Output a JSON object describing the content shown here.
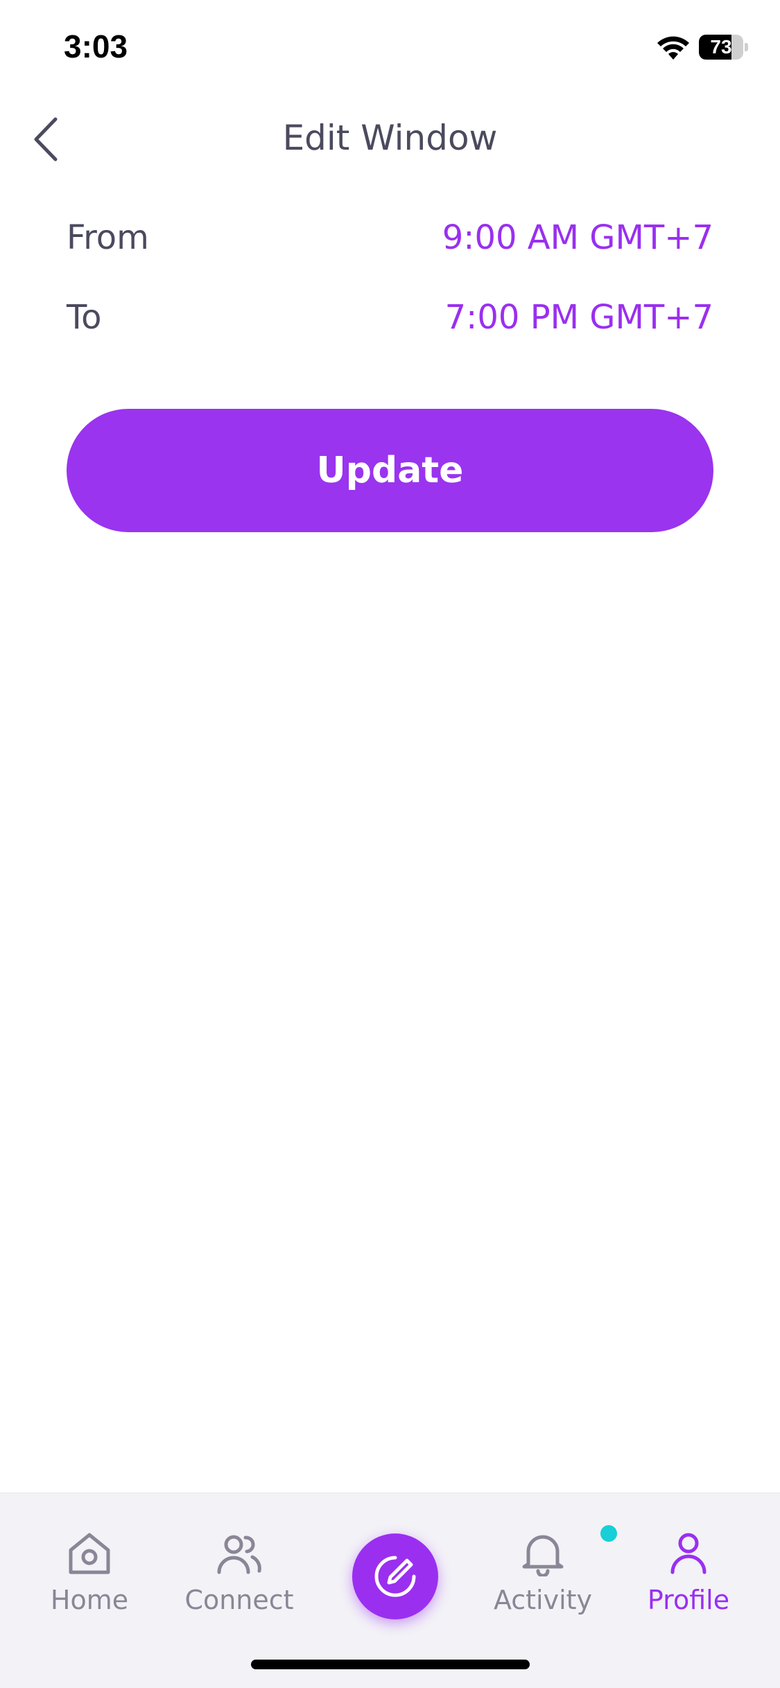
{
  "status_bar": {
    "time": "3:03",
    "battery": "73",
    "battery_level": 0.73
  },
  "header": {
    "title": "Edit Window",
    "back_icon": "chevron-left-icon"
  },
  "window": {
    "from_label": "From",
    "from_value": "9:00 AM GMT+7",
    "to_label": "To",
    "to_value": "7:00 PM GMT+7"
  },
  "update_button": {
    "label": "Update"
  },
  "tab_bar": {
    "active": "Profile",
    "items": [
      {
        "label": "Home",
        "icon": "home-icon"
      },
      {
        "label": "Connect",
        "icon": "people-icon"
      },
      {
        "label": "Activity",
        "icon": "bell-icon"
      },
      {
        "label": "Profile",
        "icon": "person-icon"
      }
    ],
    "compose_icon": "pencil-icon"
  },
  "colors": {
    "accent": "#9a2ff0",
    "text": "#4b4a5e",
    "muted": "#8a8696",
    "notification_dot": "#17cfd6"
  }
}
